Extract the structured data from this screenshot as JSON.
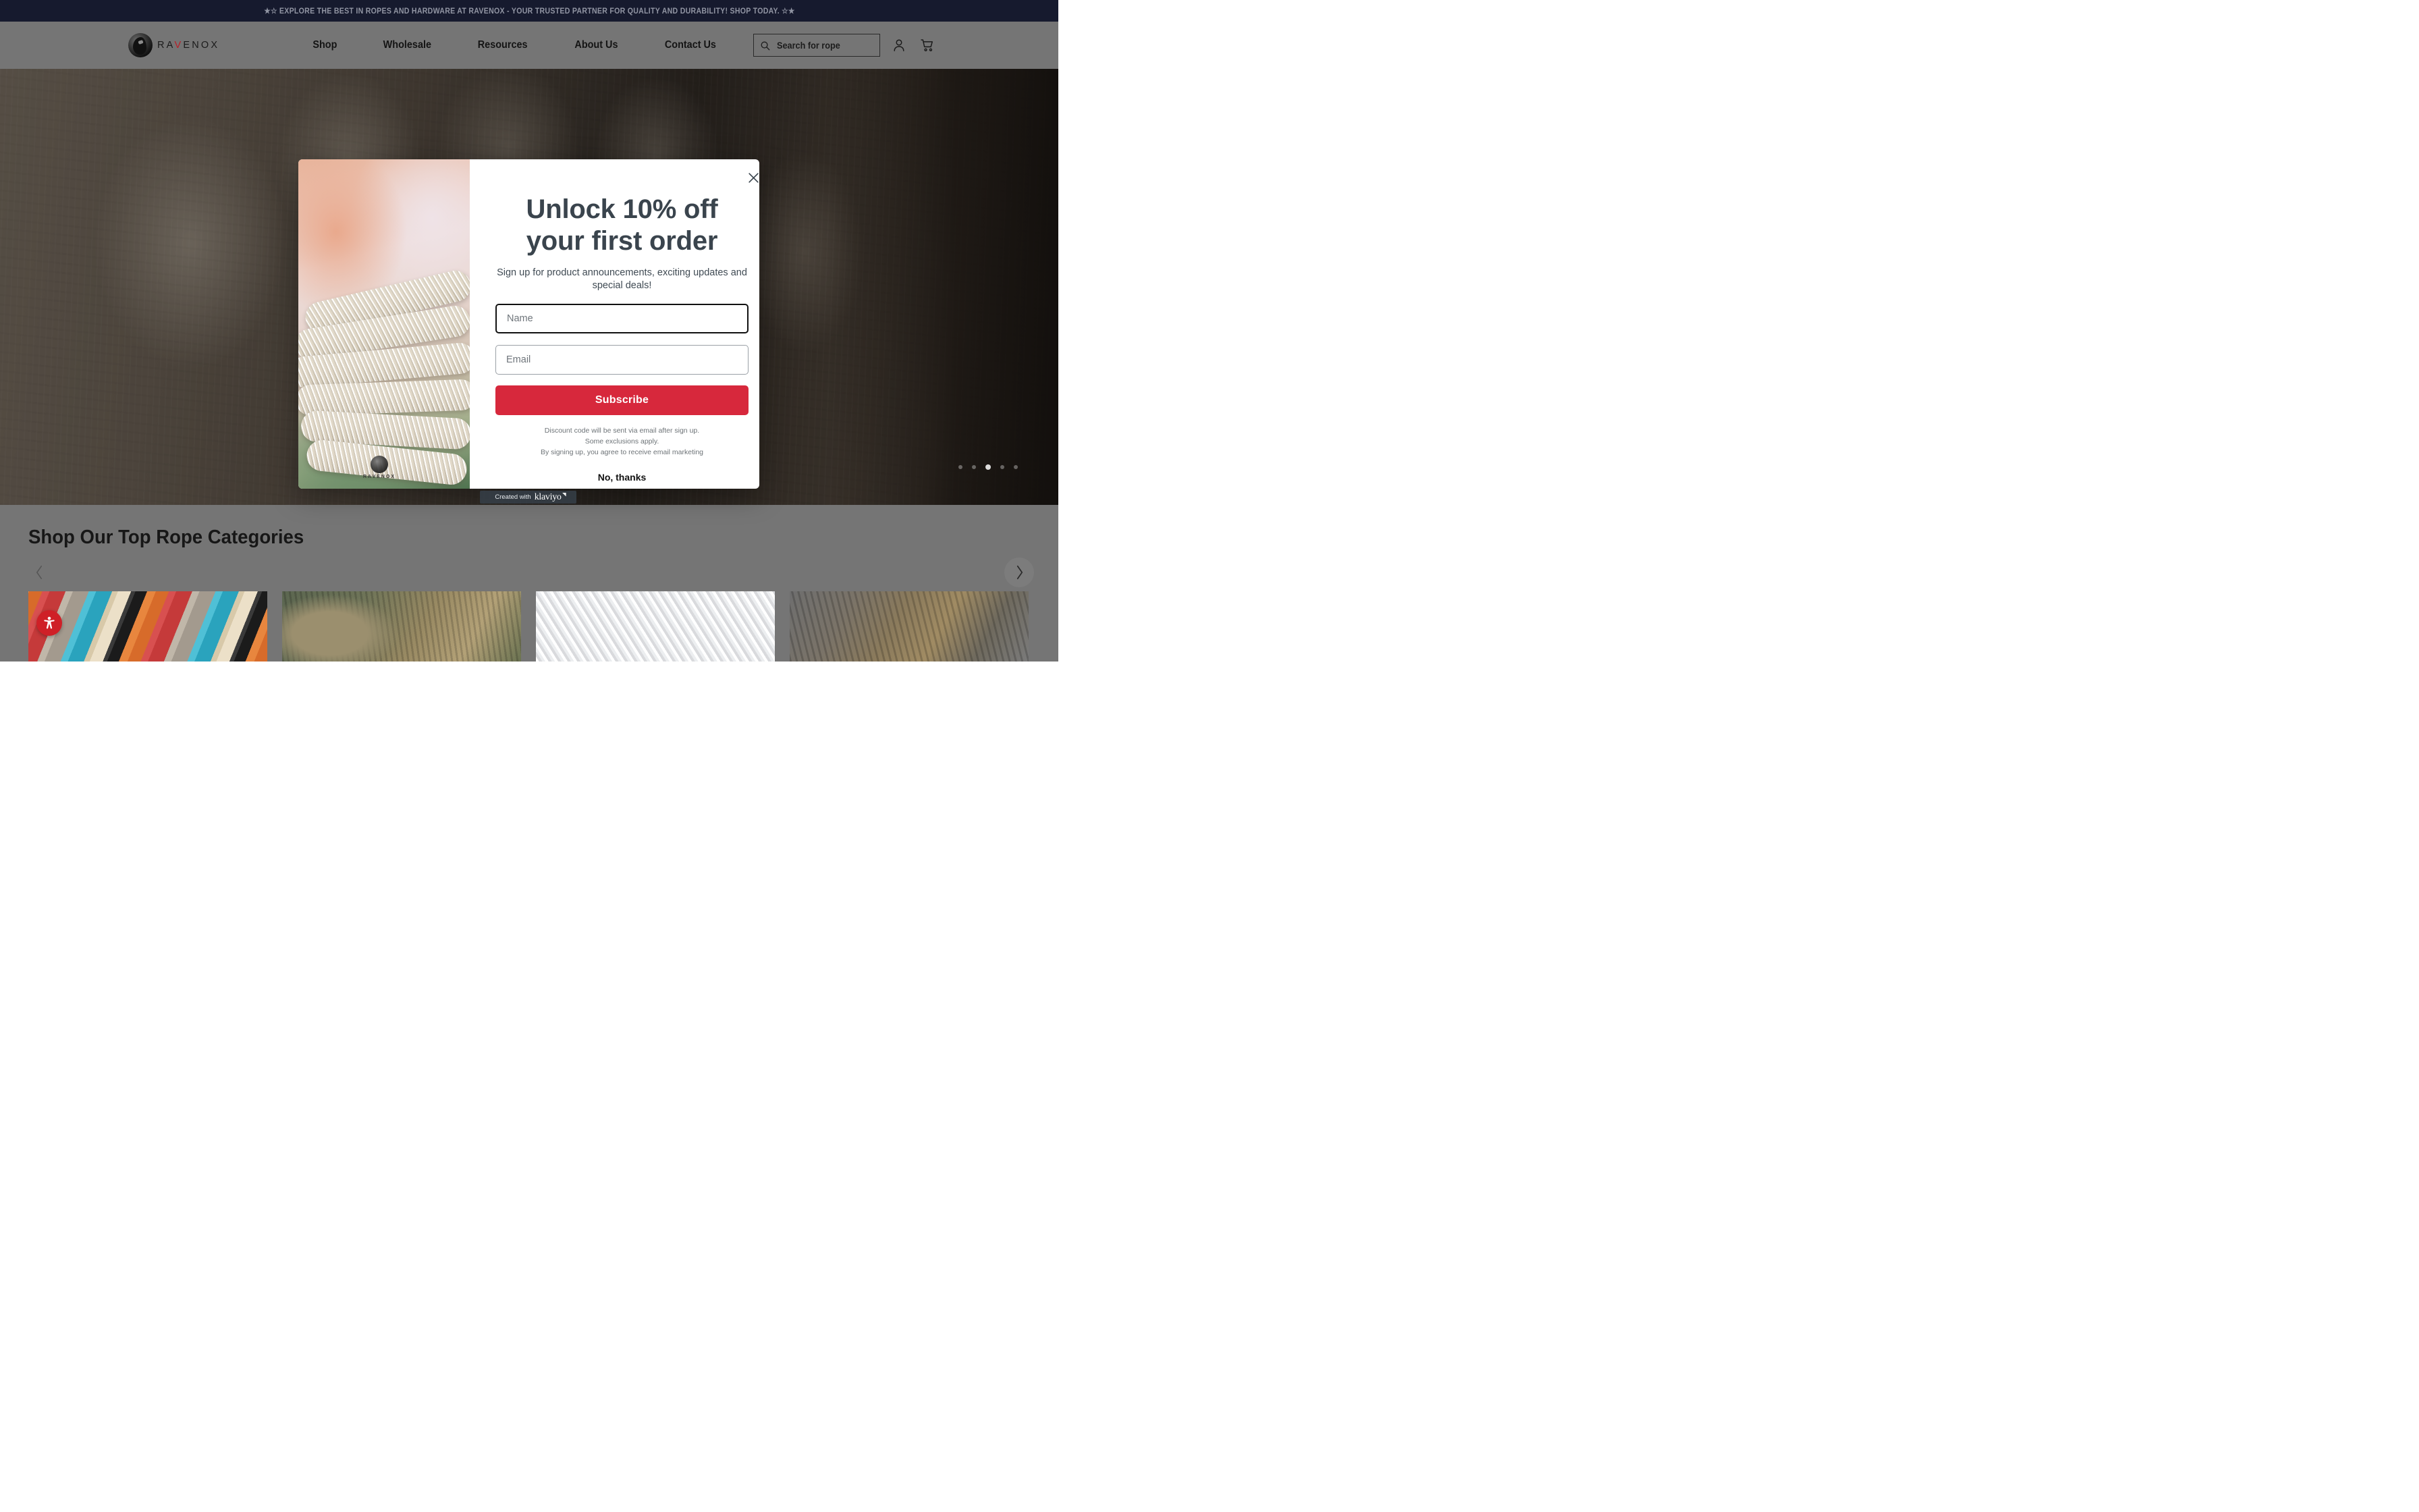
{
  "announcement": {
    "text": "★☆ EXPLORE THE BEST IN ROPES AND HARDWARE AT RAVENOX - YOUR TRUSTED PARTNER FOR QUALITY AND DURABILITY! SHOP TODAY. ☆★",
    "background_color": "#161a2e",
    "text_color": "#9195a3"
  },
  "header": {
    "background_color": "#757575",
    "brand": {
      "name_part1": "RA",
      "name_accent": "V",
      "name_part2": "ENOX",
      "accent_color": "#b81f28"
    },
    "nav": [
      {
        "label": "Shop"
      },
      {
        "label": "Wholesale"
      },
      {
        "label": "Resources"
      },
      {
        "label": "About Us"
      },
      {
        "label": "Contact Us"
      }
    ],
    "search": {
      "placeholder": "Search for rope",
      "icon": "search-icon"
    },
    "account_icon": "user-icon",
    "cart_icon": "shopping-cart-icon"
  },
  "hero": {
    "carousel_dots": 5,
    "active_dot_index": 2
  },
  "modal": {
    "close_icon": "close-icon",
    "heading": "Unlock 10% off your first order",
    "subheading": "Sign up for product announcements, exciting updates and special deals!",
    "fields": [
      {
        "name": "name",
        "placeholder": "Name",
        "value": "",
        "focused": true
      },
      {
        "name": "email",
        "placeholder": "Email",
        "value": "",
        "focused": false
      }
    ],
    "submit_label": "Subscribe",
    "submit_color": "#d7283c",
    "fine_print": [
      "Discount code will be sent via email after sign up.",
      "Some exclusions apply.",
      "By signing up, you agree to receive email marketing"
    ],
    "dismiss_label": "No, thanks",
    "image_brand_word": "RAVENOX"
  },
  "badge": {
    "prefix": "Created with",
    "brand": "klaviyo"
  },
  "categories": {
    "heading": "Shop Our Top Rope Categories",
    "prev_icon": "chevron-left-icon",
    "next_icon": "chevron-right-icon",
    "tiles": [
      {
        "id": "colored-twisted-rope"
      },
      {
        "id": "natural-manila-rope"
      },
      {
        "id": "white-braided-rope"
      },
      {
        "id": "brown-jute-rope"
      }
    ]
  },
  "accessibility": {
    "icon": "accessibility-person-icon",
    "color": "#cf2027"
  }
}
